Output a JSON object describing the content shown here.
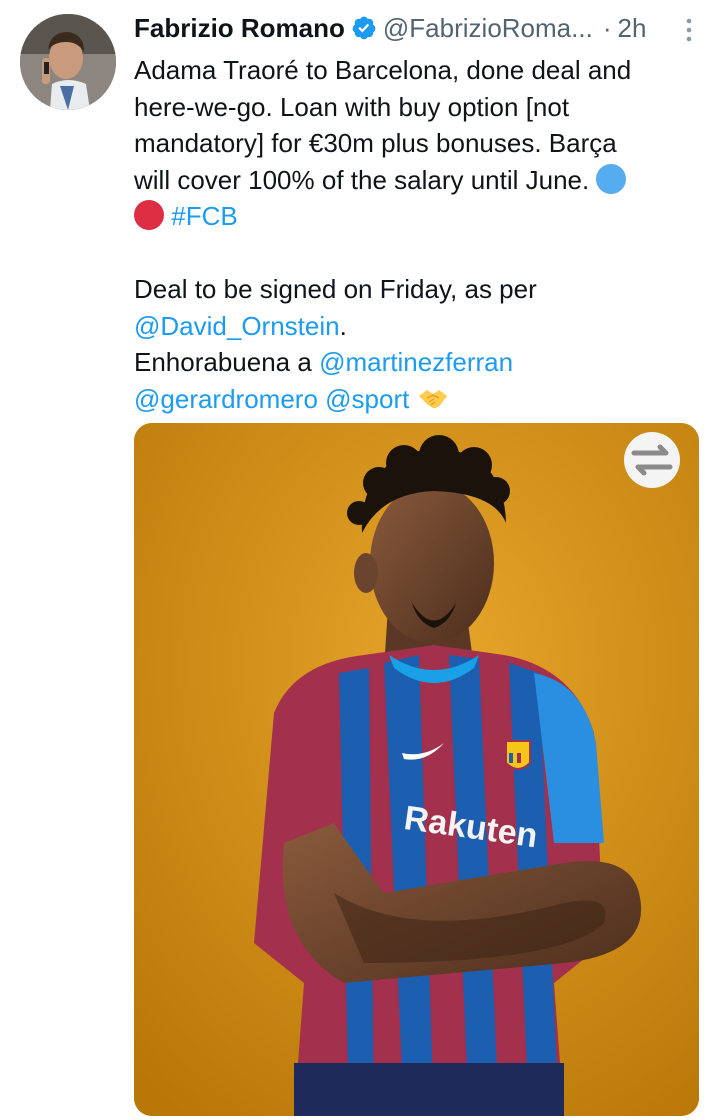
{
  "author": {
    "name": "Fabrizio Romano",
    "handle": "@FabrizioRoma...",
    "separator": "·",
    "time": "2h"
  },
  "tweet": {
    "line1": "Adama Traoré to Barcelona, done deal and",
    "line2": "here-we-go. Loan with buy option [not",
    "line3": "mandatory] for €30m plus bonuses. Barça",
    "line4": "will cover 100% of the salary until June.",
    "hashtag": "#FCB",
    "line5": "Deal to be signed on Friday, as per",
    "mention1": "@David_Ornstein",
    "mention1_suffix": ".",
    "line6_prefix": "Enhorabuena a",
    "mention2": "@martinezferran",
    "mention3": "@gerardromero",
    "mention4": "@sport"
  },
  "media": {
    "shirt_sponsor": "Rakuten"
  },
  "colors": {
    "link": "#1d9bf0",
    "blue_circle": "#55acee",
    "red_circle": "#dd2e44",
    "verified": "#1d9bf0",
    "image_background": "#d38f12"
  },
  "icons": {
    "verified": "verified-badge-icon",
    "more": "more-vertical-icon",
    "blue_circle": "blue-circle-emoji",
    "red_circle": "red-circle-emoji",
    "handshake": "handshake-emoji",
    "transfer": "transfer-arrows-icon"
  }
}
